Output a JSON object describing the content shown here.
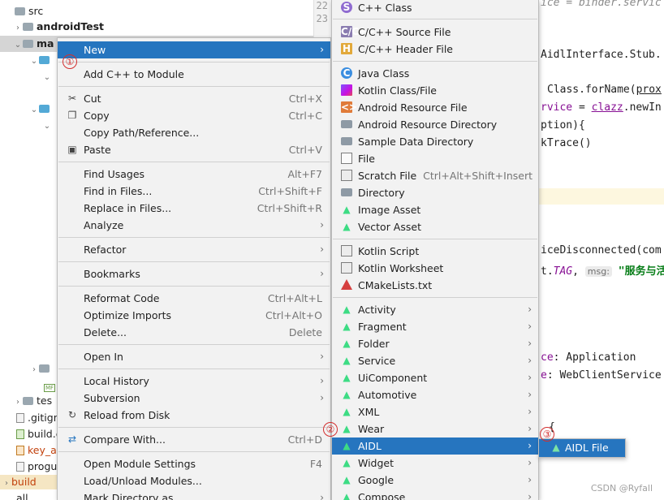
{
  "tree": {
    "items": [
      {
        "label": "src",
        "bold": false
      },
      {
        "label": "androidTest",
        "bold": true
      },
      {
        "label": "ma",
        "bold": true
      },
      {
        "label": "tes",
        "bold": false
      },
      {
        "label": ".gitign",
        "bold": false
      },
      {
        "label": "build.c",
        "bold": false
      },
      {
        "label": "key_ar",
        "bold": false
      },
      {
        "label": "progu",
        "bold": false
      },
      {
        "label": "build",
        "bold": false
      },
      {
        "label": "all",
        "bold": false
      }
    ],
    "mf_badge": "MF"
  },
  "gutter": {
    "line_top": "22",
    "line_next": "23"
  },
  "code": {
    "lines": [
      {
        "text": "ice = binder.servic"
      },
      {
        "text": "AidlInterface.Stub."
      },
      {
        "p1": "Class.forName(",
        "p2": "prox"
      },
      {
        "p1": "rvice",
        "p2": " = ",
        "p3": "clazz",
        "p4": ".newIn"
      },
      {
        "text": "ption){"
      },
      {
        "text": "kTrace()"
      },
      {
        "text": "iceDisconnected(com"
      },
      {
        "p1": "t.",
        "p2": "TAG",
        "p3": ", ",
        "hint": "msg:",
        "str": " \"服务与活"
      },
      {
        "p1": "ce",
        "p2": ": Application"
      },
      {
        "p1": "e",
        "p2": ": WebClientService"
      },
      {
        "text": "{"
      }
    ]
  },
  "menu_main": {
    "items": [
      {
        "label": "New",
        "shortcut": "",
        "submenu": true,
        "selected": true,
        "icon": ""
      },
      {
        "label": "Add C++ to Module",
        "shortcut": "",
        "submenu": false,
        "icon": ""
      },
      {
        "label": "Cut",
        "shortcut": "Ctrl+X",
        "submenu": false,
        "icon": "scissors-icon"
      },
      {
        "label": "Copy",
        "shortcut": "Ctrl+C",
        "submenu": false,
        "icon": "copy-icon"
      },
      {
        "label": "Copy Path/Reference...",
        "shortcut": "",
        "submenu": false,
        "icon": ""
      },
      {
        "label": "Paste",
        "shortcut": "Ctrl+V",
        "submenu": false,
        "icon": "paste-icon"
      },
      {
        "label": "Find Usages",
        "shortcut": "Alt+F7",
        "submenu": false,
        "icon": ""
      },
      {
        "label": "Find in Files...",
        "shortcut": "Ctrl+Shift+F",
        "submenu": false,
        "icon": ""
      },
      {
        "label": "Replace in Files...",
        "shortcut": "Ctrl+Shift+R",
        "submenu": false,
        "icon": ""
      },
      {
        "label": "Analyze",
        "shortcut": "",
        "submenu": true,
        "icon": ""
      },
      {
        "label": "Refactor",
        "shortcut": "",
        "submenu": true,
        "icon": ""
      },
      {
        "label": "Bookmarks",
        "shortcut": "",
        "submenu": true,
        "icon": ""
      },
      {
        "label": "Reformat Code",
        "shortcut": "Ctrl+Alt+L",
        "submenu": false,
        "icon": ""
      },
      {
        "label": "Optimize Imports",
        "shortcut": "Ctrl+Alt+O",
        "submenu": false,
        "icon": ""
      },
      {
        "label": "Delete...",
        "shortcut": "Delete",
        "submenu": false,
        "icon": ""
      },
      {
        "label": "Open In",
        "shortcut": "",
        "submenu": true,
        "icon": ""
      },
      {
        "label": "Local History",
        "shortcut": "",
        "submenu": true,
        "icon": ""
      },
      {
        "label": "Subversion",
        "shortcut": "",
        "submenu": true,
        "icon": ""
      },
      {
        "label": "Reload from Disk",
        "shortcut": "",
        "submenu": false,
        "icon": "reload-icon"
      },
      {
        "label": "Compare With...",
        "shortcut": "Ctrl+D",
        "submenu": false,
        "icon": "compare-icon"
      },
      {
        "label": "Open Module Settings",
        "shortcut": "F4",
        "submenu": false,
        "icon": ""
      },
      {
        "label": "Load/Unload Modules...",
        "shortcut": "",
        "submenu": false,
        "icon": ""
      },
      {
        "label": "Mark Directory as",
        "shortcut": "",
        "submenu": true,
        "icon": ""
      }
    ]
  },
  "menu_new": {
    "items": [
      {
        "label": "C++ Class",
        "shortcut": "",
        "submenu": false,
        "icon": "cpp-class-icon"
      },
      {
        "label": "C/C++ Source File",
        "shortcut": "",
        "submenu": false,
        "icon": "cpp-source-icon"
      },
      {
        "label": "C/C++ Header File",
        "shortcut": "",
        "submenu": false,
        "icon": "cpp-header-icon"
      },
      {
        "label": "Java Class",
        "shortcut": "",
        "submenu": false,
        "icon": "java-class-icon"
      },
      {
        "label": "Kotlin Class/File",
        "shortcut": "",
        "submenu": false,
        "icon": "kotlin-file-icon"
      },
      {
        "label": "Android Resource File",
        "shortcut": "",
        "submenu": false,
        "icon": "resource-file-icon"
      },
      {
        "label": "Android Resource Directory",
        "shortcut": "",
        "submenu": false,
        "icon": "folder-icon"
      },
      {
        "label": "Sample Data Directory",
        "shortcut": "",
        "submenu": false,
        "icon": "folder-icon"
      },
      {
        "label": "File",
        "shortcut": "",
        "submenu": false,
        "icon": "file-icon"
      },
      {
        "label": "Scratch File",
        "shortcut": "Ctrl+Alt+Shift+Insert",
        "submenu": false,
        "icon": "scratch-file-icon"
      },
      {
        "label": "Directory",
        "shortcut": "",
        "submenu": false,
        "icon": "folder-icon"
      },
      {
        "label": "Image Asset",
        "shortcut": "",
        "submenu": false,
        "icon": "android-icon"
      },
      {
        "label": "Vector Asset",
        "shortcut": "",
        "submenu": false,
        "icon": "android-icon"
      },
      {
        "label": "Kotlin Script",
        "shortcut": "",
        "submenu": false,
        "icon": "kotlin-script-icon"
      },
      {
        "label": "Kotlin Worksheet",
        "shortcut": "",
        "submenu": false,
        "icon": "kotlin-worksheet-icon"
      },
      {
        "label": "CMakeLists.txt",
        "shortcut": "",
        "submenu": false,
        "icon": "cmake-icon"
      },
      {
        "label": "Activity",
        "shortcut": "",
        "submenu": true,
        "icon": "android-icon"
      },
      {
        "label": "Fragment",
        "shortcut": "",
        "submenu": true,
        "icon": "android-icon"
      },
      {
        "label": "Folder",
        "shortcut": "",
        "submenu": true,
        "icon": "android-icon"
      },
      {
        "label": "Service",
        "shortcut": "",
        "submenu": true,
        "icon": "android-icon"
      },
      {
        "label": "UiComponent",
        "shortcut": "",
        "submenu": true,
        "icon": "android-icon"
      },
      {
        "label": "Automotive",
        "shortcut": "",
        "submenu": true,
        "icon": "android-icon"
      },
      {
        "label": "XML",
        "shortcut": "",
        "submenu": true,
        "icon": "android-icon"
      },
      {
        "label": "Wear",
        "shortcut": "",
        "submenu": true,
        "icon": "android-icon"
      },
      {
        "label": "AIDL",
        "shortcut": "",
        "submenu": true,
        "selected": true,
        "icon": "android-icon"
      },
      {
        "label": "Widget",
        "shortcut": "",
        "submenu": true,
        "icon": "android-icon"
      },
      {
        "label": "Google",
        "shortcut": "",
        "submenu": true,
        "icon": "android-icon"
      },
      {
        "label": "Compose",
        "shortcut": "",
        "submenu": true,
        "icon": "android-icon"
      }
    ]
  },
  "menu_aidl": {
    "items": [
      {
        "label": "AIDL File",
        "selected": true,
        "icon": "aidl-file-icon"
      }
    ]
  },
  "annotations": {
    "step1": "①",
    "step2": "②",
    "step3": "③"
  },
  "watermark": "CSDN @Ryfall",
  "colors": {
    "selection": "#2675bf",
    "menu_bg": "#f2f2f2",
    "annotation_red": "#d32f2f"
  }
}
